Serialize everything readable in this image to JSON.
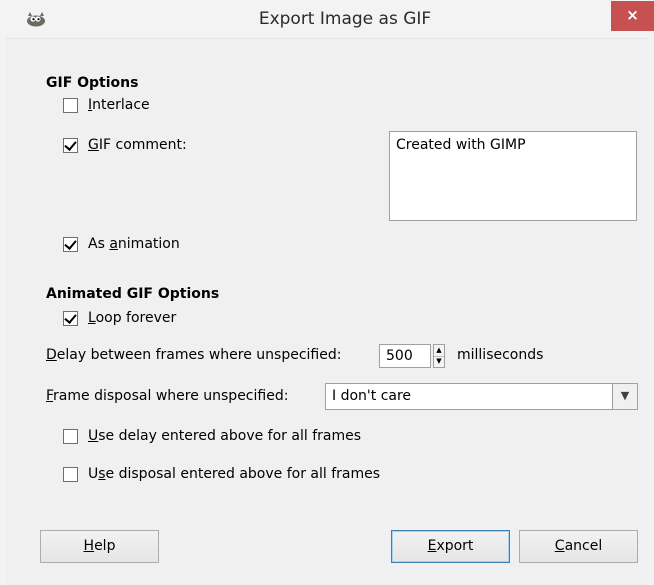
{
  "window": {
    "title": "Export Image as GIF",
    "close_symbol": "×"
  },
  "gif_options": {
    "heading": "GIF Options",
    "interlace": {
      "mnemonic": "I",
      "rest": "nterlace",
      "checked": false
    },
    "gif_comment": {
      "mnemonic": "G",
      "rest": "IF comment:",
      "checked": true
    },
    "comment_text": "Created with GIMP",
    "as_animation": {
      "pre": "As ",
      "mnemonic": "a",
      "rest": "nimation",
      "checked": true
    }
  },
  "animated_options": {
    "heading": "Animated GIF Options",
    "loop_forever": {
      "mnemonic": "L",
      "rest": "oop forever",
      "checked": true
    },
    "delay": {
      "mnemonic": "D",
      "rest": "elay between frames where unspecified:",
      "value": "500",
      "unit": "milliseconds"
    },
    "disposal": {
      "mnemonic": "F",
      "rest": "rame disposal where unspecified:",
      "selected": "I don't care"
    },
    "use_delay": {
      "mnemonic": "U",
      "rest": "se delay entered above for all frames",
      "checked": false
    },
    "use_disposal": {
      "pre": "U",
      "mnemonic": "s",
      "rest": "e disposal entered above for all frames",
      "checked": false
    }
  },
  "buttons": {
    "help": {
      "mnemonic": "H",
      "rest": "elp"
    },
    "export": {
      "mnemonic": "E",
      "rest": "xport"
    },
    "cancel": {
      "mnemonic": "C",
      "rest": "ancel"
    }
  },
  "icons": {
    "app": "gimp-wilber-icon",
    "close": "close-icon",
    "spin_up": "spin-up-icon",
    "spin_down": "spin-down-icon",
    "dropdown": "chevron-down-icon"
  },
  "colors": {
    "close_button": "#c75050",
    "default_button_border": "#3c7fb1"
  }
}
